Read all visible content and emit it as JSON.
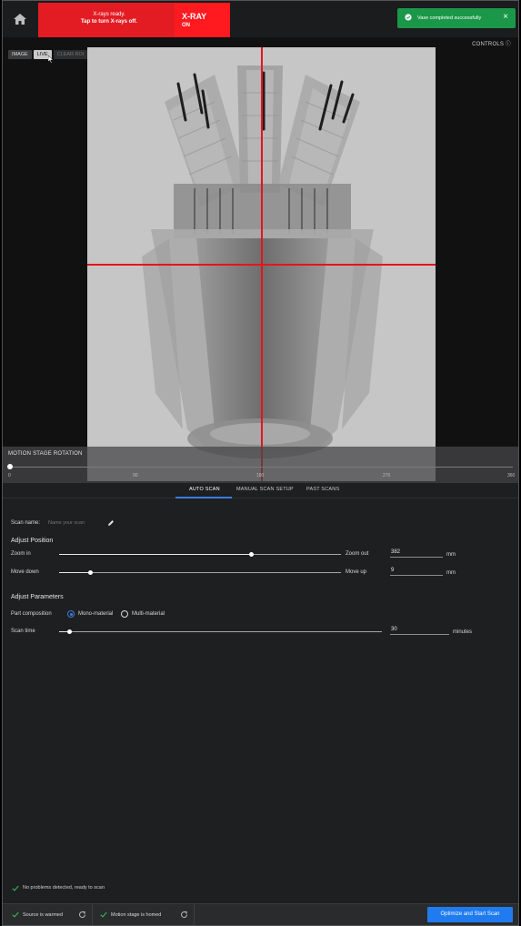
{
  "header": {
    "home_icon": "home-icon",
    "xray_message_line1": "X-rays ready.",
    "xray_message_line2": "Tap to turn X-rays off.",
    "xray_title": "X-RAY",
    "xray_state": "ON",
    "banner_color": "#e31c23",
    "toast": {
      "text": "Vase completed successfully",
      "close": "×",
      "color": "#1a9748"
    }
  },
  "viewer": {
    "controls_label": "CONTROLS",
    "controls_icon": "ⓘ",
    "view_tabs": [
      "IMAGE",
      "LIVE",
      "CLEAR ROI"
    ],
    "crosshair_color": "#e4151d"
  },
  "rotation": {
    "label": "MOTION STAGE ROTATION",
    "ticks": [
      "0",
      "90",
      "180",
      "270",
      "360"
    ],
    "value": 0
  },
  "tabs": {
    "items": [
      "AUTO SCAN",
      "MANUAL SCAN SETUP",
      "PAST SCANS"
    ],
    "active": "AUTO SCAN",
    "accent": "#3a7de0"
  },
  "scan": {
    "name_label": "Scan name:",
    "name_placeholder": "Name your scan"
  },
  "position": {
    "title": "Adjust Position",
    "zoom_in": "Zoom in",
    "zoom_out": "Zoom out",
    "zoom_value": "382",
    "zoom_unit": "mm",
    "zoom_fraction": 0.68,
    "move_down": "Move down",
    "move_up": "Move up",
    "move_value": "9",
    "move_unit": "mm",
    "move_fraction": 0.11
  },
  "parameters": {
    "title": "Adjust Parameters",
    "part_label": "Part composition",
    "options": [
      "Mono-material",
      "Multi-material"
    ],
    "selected": "Mono-material",
    "scan_time_label": "Scan time",
    "scan_time_value": "30",
    "scan_time_unit": "minutes",
    "scan_time_fraction": 0.03
  },
  "status": {
    "ready": "No problems detected, ready to scan",
    "source": "Source is warmed",
    "motion": "Motion stage is homed",
    "start_button": "Optimize and Start Scan",
    "button_color": "#1f7bef"
  }
}
